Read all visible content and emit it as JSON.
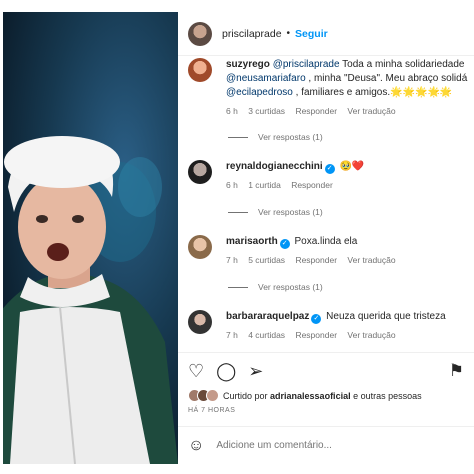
{
  "colors": {
    "accent": "#0095f6",
    "mention": "#00376b",
    "meta": "#737373"
  },
  "post": {
    "author": "priscilaprade",
    "separator": "•",
    "follow_label": "Seguir"
  },
  "comments": [
    {
      "user": "suzyrego",
      "verified": false,
      "line1_mention": "@priscilaprade",
      "line1_text": " Toda a minha solidariedade",
      "line2_mention": "@neusamariafaro",
      "line2_text": " , minha \"Deusa\". Meu abraço solidá",
      "line3_mention": "@ecilapedroso",
      "line3_text": " , familiares e amigos.🌟🌟🌟🌟🌟",
      "time": "6 h",
      "likes": "3 curtidas",
      "reply": "Responder",
      "translate": "Ver tradução",
      "see_replies": "Ver respostas (1)"
    },
    {
      "user": "reynaldogianecchini",
      "verified": true,
      "text": "🥹❤️",
      "time": "6 h",
      "likes": "1 curtida",
      "reply": "Responder",
      "see_replies": "Ver respostas (1)"
    },
    {
      "user": "marisaorth",
      "verified": true,
      "text": "Poxa.linda ela",
      "time": "7 h",
      "likes": "5 curtidas",
      "reply": "Responder",
      "translate": "Ver tradução",
      "see_replies": "Ver respostas (1)"
    },
    {
      "user": "barbararaquelpaz",
      "verified": true,
      "text": "Neuza querida que tristeza",
      "time": "7 h",
      "likes": "4 curtidas",
      "reply": "Responder",
      "translate": "Ver tradução"
    }
  ],
  "actions": {
    "like_icon": "heart-icon",
    "comment_icon": "comment-icon",
    "share_icon": "share-icon",
    "save_icon": "bookmark-icon"
  },
  "liked_by": {
    "prefix": "Curtido por ",
    "user": "adrianalessaoficial",
    "suffix": " e outras pessoas"
  },
  "timestamp": "HÁ 7 HORAS",
  "add_comment": {
    "placeholder": "Adicione um comentário..."
  }
}
